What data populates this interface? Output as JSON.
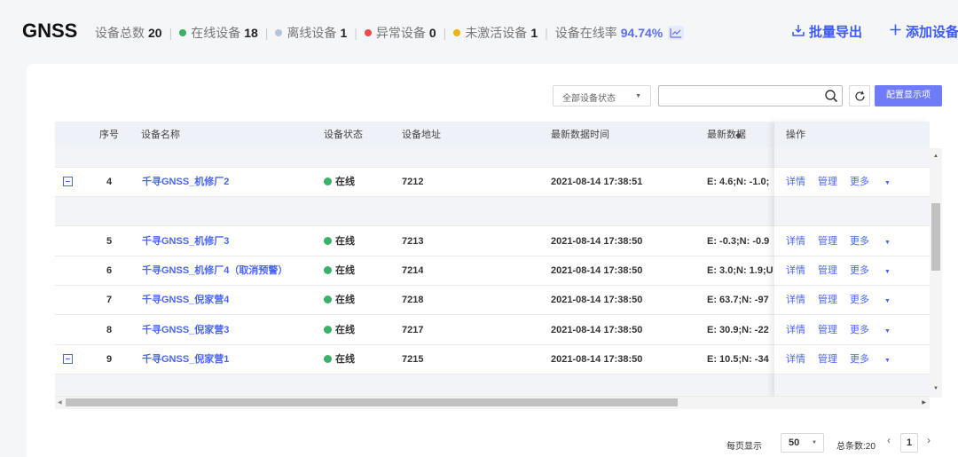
{
  "header": {
    "title": "GNSS",
    "stats": {
      "total_label": "设备总数",
      "total_value": "20",
      "online_label": "在线设备",
      "online_value": "18",
      "offline_label": "离线设备",
      "offline_value": "1",
      "abnormal_label": "异常设备",
      "abnormal_value": "0",
      "inactive_label": "未激活设备",
      "inactive_value": "1",
      "rate_label": "设备在线率",
      "rate_value": "94.74%"
    },
    "export_label": "批量导出",
    "add_label": "添加设备"
  },
  "colors": {
    "online": "#38b267",
    "offline": "#b9c2dc",
    "abnormal": "#ef4b4b",
    "inactive": "#f2b300",
    "accent": "#3d5afe"
  },
  "toolbar": {
    "status_select_value": "全部设备状态",
    "search_value": "",
    "config_label": "配置显示项"
  },
  "table": {
    "columns": {
      "index": "序号",
      "name": "设备名称",
      "status": "设备状态",
      "address": "设备地址",
      "time": "最新数据时间",
      "data": "最新数据",
      "ops": "操作"
    },
    "rows": [
      {
        "index": "4",
        "name": "千寻GNSS_机修厂2",
        "status": "在线",
        "address": "7212",
        "time": "2021-08-14 17:38:51",
        "data": "E: 4.6;N: -1.0;",
        "expanded": true
      },
      {
        "index": "5",
        "name": "千寻GNSS_机修厂3",
        "status": "在线",
        "address": "7213",
        "time": "2021-08-14 17:38:50",
        "data": "E: -0.3;N: -0.9",
        "expanded": false
      },
      {
        "index": "6",
        "name": "千寻GNSS_机修厂4（取消预警）",
        "status": "在线",
        "address": "7214",
        "time": "2021-08-14 17:38:50",
        "data": "E: 3.0;N: 1.9;U",
        "expanded": false
      },
      {
        "index": "7",
        "name": "千寻GNSS_倪家营4",
        "status": "在线",
        "address": "7218",
        "time": "2021-08-14 17:38:50",
        "data": "E: 63.7;N: -97",
        "expanded": false
      },
      {
        "index": "8",
        "name": "千寻GNSS_倪家营3",
        "status": "在线",
        "address": "7217",
        "time": "2021-08-14 17:38:50",
        "data": "E: 30.9;N: -22",
        "expanded": false
      },
      {
        "index": "9",
        "name": "千寻GNSS_倪家营1",
        "status": "在线",
        "address": "7215",
        "time": "2021-08-14 17:38:50",
        "data": "E: 10.5;N: -34",
        "expanded": true
      }
    ],
    "ops": {
      "detail": "详情",
      "manage": "管理",
      "more": "更多"
    }
  },
  "pagination": {
    "per_page_label": "每页显示",
    "per_page_value": "50",
    "total_label": "总条数:20",
    "current_page": "1"
  }
}
